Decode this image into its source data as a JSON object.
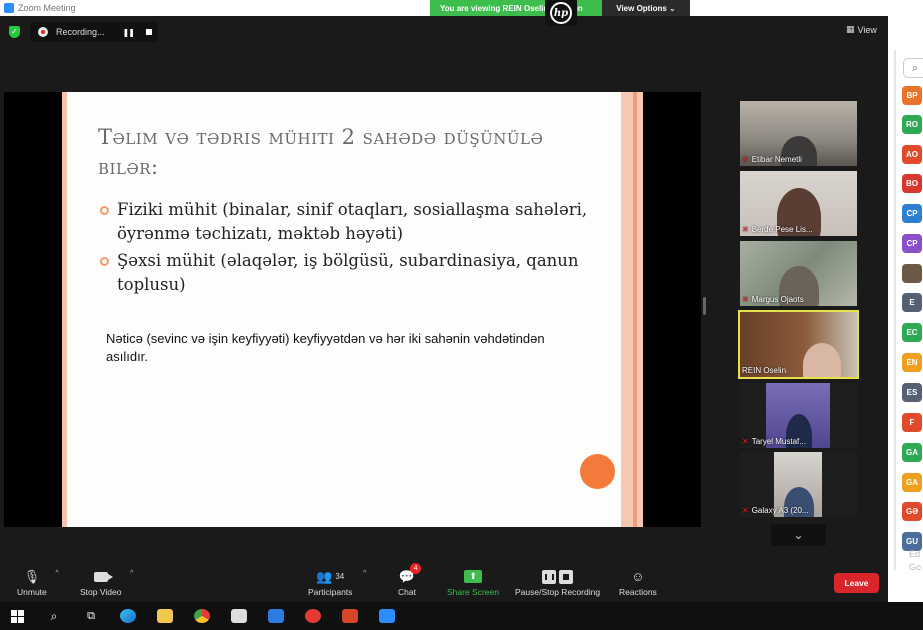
{
  "window": {
    "title": "Zoom Meeting"
  },
  "banner": {
    "viewing_text": "You are viewing REIN Oselin's screen",
    "view_options_label": "View Options ⌄"
  },
  "hp_logo": "hp",
  "recording": {
    "label": "Recording..."
  },
  "view_button": {
    "label": "View"
  },
  "slide": {
    "title": "Təlim və tədris mühiti 2 sahədə düşünülə bilər:",
    "bullets": [
      "Fiziki mühit (binalar, sinif otaqları, sosiallaşma sahələri, öyrənmə təchizatı, məktəb həyəti)",
      "Şəxsi mühit (əlaqələr, iş bölgüsü, subardinasiya, qanun toplusu)"
    ],
    "conclusion": "Nəticə (sevinc və işin keyfiyyəti) keyfiyyətdən və hər iki sahənin vəhdətindən asılıdır.",
    "accent_color": "#f47a3c"
  },
  "video_tiles": [
    {
      "name": "Etibar Nemetli",
      "muted": true
    },
    {
      "name": "Berde Pese Lis...",
      "muted": true
    },
    {
      "name": "Margus Ojaots",
      "muted": true
    },
    {
      "name": "REIN Oselin",
      "muted": false,
      "active": true
    },
    {
      "name": "Taryel Mustaf...",
      "muted": true
    },
    {
      "name": "Galaxy A3 (20...",
      "muted": true
    }
  ],
  "participants_panel": {
    "avatars": [
      {
        "initials": "BP",
        "color": "#e8732a"
      },
      {
        "initials": "RO",
        "color": "#2eaa55"
      },
      {
        "initials": "AO",
        "color": "#e04a2a"
      },
      {
        "initials": "BO",
        "color": "#d9382f"
      },
      {
        "initials": "CP",
        "color": "#2f7fd0"
      },
      {
        "initials": "CP",
        "color": "#8b4fc9"
      },
      {
        "initials": "",
        "color": "#6b5a46",
        "photo": true
      },
      {
        "initials": "E",
        "color": "#556070"
      },
      {
        "initials": "EC",
        "color": "#2eaa55"
      },
      {
        "initials": "EN",
        "color": "#f0a020"
      },
      {
        "initials": "ES",
        "color": "#556070"
      },
      {
        "initials": "F",
        "color": "#e04a2a"
      },
      {
        "initials": "GA",
        "color": "#2eaa55"
      },
      {
        "initials": "GA",
        "color": "#f0a020"
      },
      {
        "initials": "GƏ",
        "color": "#e04a2a"
      },
      {
        "initials": "GU",
        "color": "#4a6d9a"
      }
    ],
    "trailing_text": [
      "Ed",
      "Go"
    ]
  },
  "toolbar": {
    "unmute": "Unmute",
    "stop_video": "Stop Video",
    "participants": "Participants",
    "participants_count": "34",
    "chat": "Chat",
    "chat_badge": "4",
    "share_screen": "Share Screen",
    "pause_stop_recording": "Pause/Stop Recording",
    "reactions": "Reactions",
    "leave": "Leave"
  },
  "taskbar_icons": [
    "windows-start",
    "search",
    "task-view",
    "edge",
    "file-explorer",
    "chrome",
    "store",
    "mail",
    "opera",
    "powerpoint",
    "zoom"
  ]
}
